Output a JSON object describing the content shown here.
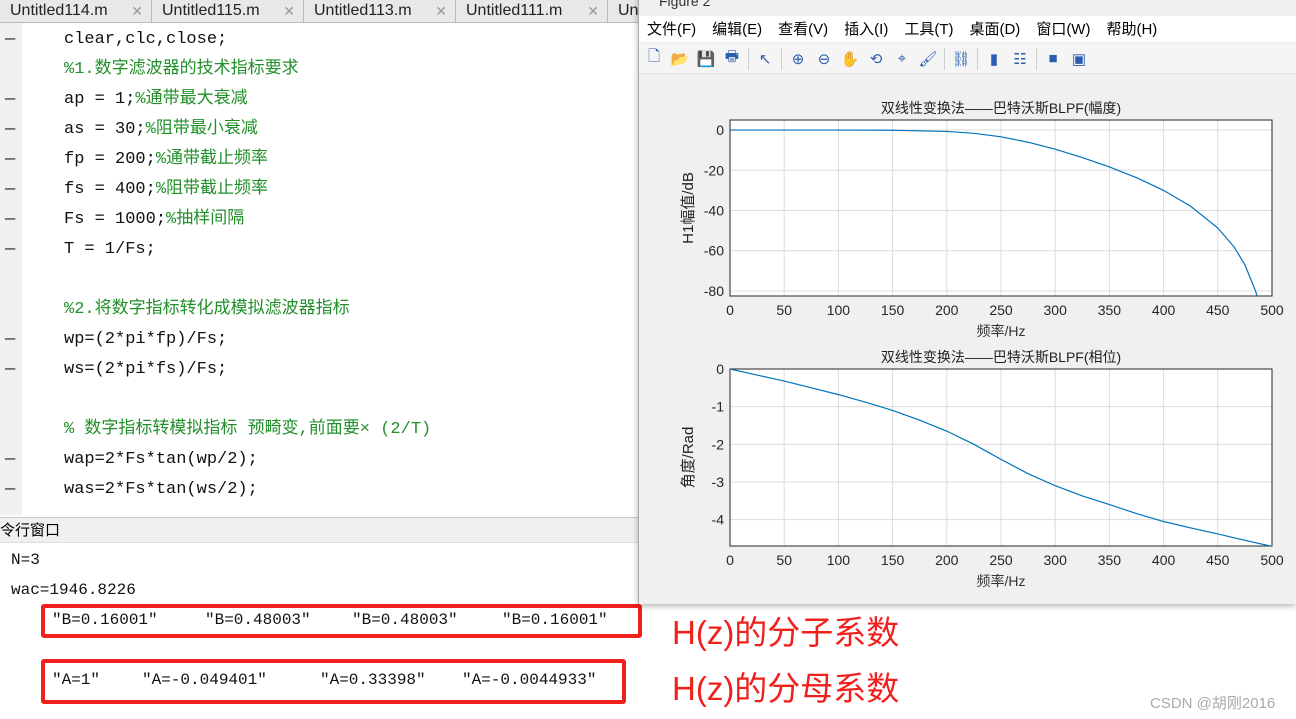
{
  "tabs": [
    {
      "label": "Untitled114.m"
    },
    {
      "label": "Untitled115.m"
    },
    {
      "label": "Untitled113.m"
    },
    {
      "label": "Untitled111.m"
    },
    {
      "label": "Untitled"
    }
  ],
  "editor": {
    "lines": [
      {
        "code": "clear,clc,close;",
        "comment": "",
        "marker": true
      },
      {
        "code": "",
        "comment": "%1.数字滤波器的技术指标要求",
        "marker": false
      },
      {
        "code": "ap = 1;",
        "comment": "%通带最大衰减",
        "marker": true
      },
      {
        "code": "as = 30;",
        "comment": "%阻带最小衰减",
        "marker": true
      },
      {
        "code": "fp = 200;",
        "comment": "%通带截止频率",
        "marker": true
      },
      {
        "code": "fs = 400;",
        "comment": "%阻带截止频率",
        "marker": true
      },
      {
        "code": "Fs = 1000;",
        "comment": "%抽样间隔",
        "marker": true
      },
      {
        "code": "T = 1/Fs;",
        "comment": "",
        "marker": true
      },
      {
        "code": "",
        "comment": "",
        "marker": false
      },
      {
        "code": "",
        "comment": "%2.将数字指标转化成模拟滤波器指标",
        "marker": false
      },
      {
        "code": "wp=(2*pi*fp)/Fs;",
        "comment": "",
        "marker": true
      },
      {
        "code": "ws=(2*pi*fs)/Fs;",
        "comment": "",
        "marker": true
      },
      {
        "code": "",
        "comment": "",
        "marker": false
      },
      {
        "code": "",
        "comment": "% 数字指标转模拟指标 预畸变,前面要× (2/T)",
        "marker": false
      },
      {
        "code": "wap=2*Fs*tan(wp/2);",
        "comment": "",
        "marker": true
      },
      {
        "code": "was=2*Fs*tan(ws/2);",
        "comment": "",
        "marker": true
      }
    ]
  },
  "command_window": {
    "title": "令行窗口",
    "output": [
      "N=3",
      "wac=1946.8226"
    ],
    "numerator": [
      "\"B=0.16001\"",
      "\"B=0.48003\"",
      "\"B=0.48003\"",
      "\"B=0.16001\""
    ],
    "denominator": [
      "\"A=1\"",
      "\"A=-0.049401\"",
      "\"A=0.33398\"",
      "\"A=-0.0044933\""
    ]
  },
  "annotations": {
    "numerator": "H(z)的分子系数",
    "denominator": "H(z)的分母系数",
    "color": "#f0201c"
  },
  "watermark": "CSDN @胡刚2016",
  "figure": {
    "title": "Figure 2",
    "menu": [
      "文件(F)",
      "编辑(E)",
      "查看(V)",
      "插入(I)",
      "工具(T)",
      "桌面(D)",
      "窗口(W)",
      "帮助(H)"
    ],
    "toolbar": [
      "new-figure-icon",
      "open-icon",
      "save-icon",
      "print-icon",
      "pointer-icon",
      "zoom-in-icon",
      "zoom-out-icon",
      "pan-icon",
      "rotate-icon",
      "data-cursor-icon",
      "brush-icon",
      "link-icon",
      "colorbar-icon",
      "legend-icon",
      "hide-plot-tools-icon",
      "show-plot-tools-icon"
    ]
  },
  "chart_data": [
    {
      "type": "line",
      "title": "双线性变换法——巴特沃斯BLPF(幅度)",
      "xlabel": "频率/Hz",
      "ylabel": "H1幅值/dB",
      "xlim": [
        0,
        500
      ],
      "ylim": [
        -82.5,
        5
      ],
      "grid": true,
      "xticks": [
        0,
        50,
        100,
        150,
        200,
        250,
        300,
        350,
        400,
        450,
        500
      ],
      "yticks": [
        0,
        -20,
        -40,
        -60,
        -80
      ],
      "color": "#0072bd",
      "x": [
        0,
        50,
        100,
        150,
        200,
        225,
        250,
        275,
        300,
        325,
        350,
        375,
        400,
        425,
        450,
        465,
        475,
        485,
        487
      ],
      "y": [
        0,
        0,
        -0.01,
        -0.09,
        -0.69,
        -1.63,
        -3.37,
        -6.05,
        -9.53,
        -13.66,
        -18.35,
        -23.67,
        -30.0,
        -37.9,
        -48.7,
        -58.1,
        -67.0,
        -80.3,
        -84.1
      ]
    },
    {
      "type": "line",
      "title": "双线性变换法——巴特沃斯BLPF(相位)",
      "xlabel": "频率/Hz",
      "ylabel": "角度/Rad",
      "xlim": [
        0,
        500
      ],
      "ylim": [
        -4.7,
        0
      ],
      "grid": true,
      "xticks": [
        0,
        50,
        100,
        150,
        200,
        250,
        300,
        350,
        400,
        450,
        500
      ],
      "yticks": [
        0,
        -1,
        -2,
        -3,
        -4
      ],
      "color": "#0072bd",
      "x": [
        0,
        25,
        50,
        75,
        100,
        125,
        150,
        175,
        200,
        225,
        250,
        275,
        300,
        325,
        350,
        375,
        400,
        425,
        450,
        475,
        500
      ],
      "y": [
        0,
        -0.16,
        -0.32,
        -0.5,
        -0.68,
        -0.88,
        -1.1,
        -1.36,
        -1.65,
        -2.0,
        -2.4,
        -2.78,
        -3.1,
        -3.37,
        -3.6,
        -3.84,
        -4.05,
        -4.22,
        -4.38,
        -4.55,
        -4.71
      ]
    }
  ]
}
